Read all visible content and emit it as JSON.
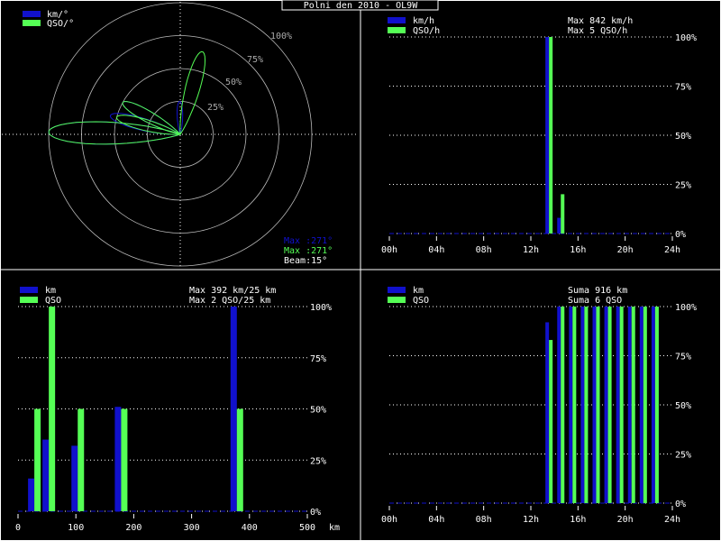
{
  "title": "Polni den 2010 - OL9W",
  "colors": {
    "blue": "#1111cc",
    "green": "#55ff55",
    "white": "#ffffff",
    "grid": "#cccccc"
  },
  "polar": {
    "legend": [
      {
        "label": "km/°",
        "color": "#1111cc"
      },
      {
        "label": "QSO/°",
        "color": "#55ff55"
      }
    ],
    "ring_labels": [
      "25%",
      "50%",
      "75%",
      "100%"
    ],
    "max_km": "Max :271°",
    "max_qso": "Max :271°",
    "beam": "Beam:15°",
    "chart_data": {
      "type": "polar",
      "beam_deg": 15,
      "km_lobes": [
        {
          "az": 271,
          "r": 1.0
        },
        {
          "az": 285,
          "r": 0.55
        },
        {
          "az": 299,
          "r": 0.5
        },
        {
          "az": 359,
          "r": 0.25
        }
      ],
      "qso_lobes": [
        {
          "az": 271,
          "r": 1.0
        },
        {
          "az": 285,
          "r": 0.5
        },
        {
          "az": 299,
          "r": 0.5
        },
        {
          "az": 15,
          "r": 0.65
        }
      ]
    }
  },
  "hourly": {
    "legend": [
      {
        "label": "km/h",
        "color": "#1111cc"
      },
      {
        "label": "QSO/h",
        "color": "#55ff55"
      }
    ],
    "max_km": "Max   842 km/h",
    "max_qso": "Max    5 QSO/h",
    "y_ticks": [
      "0%",
      "25%",
      "50%",
      "75%",
      "100%"
    ],
    "x_ticks": [
      "00h",
      "04h",
      "08h",
      "12h",
      "16h",
      "20h",
      "24h"
    ],
    "chart_data": {
      "type": "bar",
      "x": [
        14,
        15
      ],
      "series": [
        {
          "name": "km/h",
          "values": [
            100,
            8
          ]
        },
        {
          "name": "QSO/h",
          "values": [
            100,
            20
          ]
        }
      ],
      "xlim": [
        0,
        24
      ],
      "ylim": [
        0,
        100
      ]
    }
  },
  "distance": {
    "legend": [
      {
        "label": "km",
        "color": "#1111cc"
      },
      {
        "label": "QSO",
        "color": "#55ff55"
      }
    ],
    "max_km": "Max   392 km/25 km",
    "max_qso": "Max    2 QSO/25 km",
    "y_ticks": [
      "0%",
      "25%",
      "50%",
      "75%",
      "100%"
    ],
    "x_ticks": [
      "0",
      "100",
      "200",
      "300",
      "400",
      "500"
    ],
    "x_unit": "km",
    "chart_data": {
      "type": "bar",
      "x": [
        50,
        75,
        125,
        200,
        400
      ],
      "series": [
        {
          "name": "km",
          "values": [
            16,
            35,
            32,
            51,
            100
          ]
        },
        {
          "name": "QSO",
          "values": [
            50,
            100,
            50,
            50,
            50
          ]
        }
      ],
      "xlim": [
        0,
        500
      ],
      "ylim": [
        0,
        100
      ]
    }
  },
  "cumulative": {
    "legend": [
      {
        "label": "km",
        "color": "#1111cc"
      },
      {
        "label": "QSO",
        "color": "#55ff55"
      }
    ],
    "sum_km": "Suma   916 km",
    "sum_qso": "Suma    6 QSO",
    "y_ticks": [
      "0%",
      "25%",
      "50%",
      "75%",
      "100%"
    ],
    "x_ticks": [
      "00h",
      "04h",
      "08h",
      "12h",
      "16h",
      "20h",
      "24h"
    ],
    "chart_data": {
      "type": "bar",
      "x": [
        14,
        15,
        16,
        17,
        18,
        19,
        20,
        21,
        22,
        23
      ],
      "series": [
        {
          "name": "km",
          "values": [
            92,
            100,
            100,
            100,
            100,
            100,
            100,
            100,
            100,
            100
          ]
        },
        {
          "name": "QSO",
          "values": [
            83,
            100,
            100,
            100,
            100,
            100,
            100,
            100,
            100,
            100
          ]
        }
      ],
      "xlim": [
        0,
        24
      ],
      "ylim": [
        0,
        100
      ]
    }
  }
}
